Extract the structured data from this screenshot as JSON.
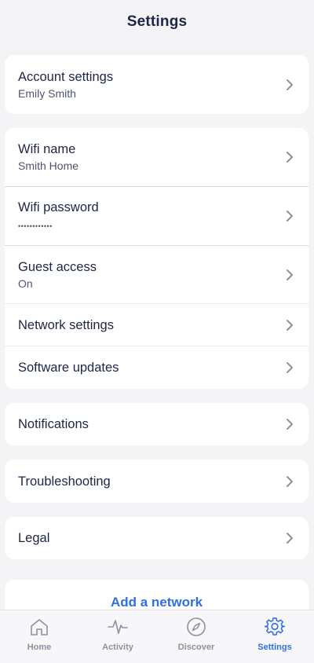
{
  "header": {
    "title": "Settings"
  },
  "account": {
    "label": "Account settings",
    "sub": "Emily Smith"
  },
  "wifi": {
    "name_label": "Wifi name",
    "name_value": "Smith Home",
    "password_label": "Wifi password",
    "password_value": "••••••••••••",
    "guest_label": "Guest access",
    "guest_value": "On",
    "network_label": "Network settings",
    "software_label": "Software updates"
  },
  "notifications": {
    "label": "Notifications"
  },
  "troubleshooting": {
    "label": "Troubleshooting"
  },
  "legal": {
    "label": "Legal"
  },
  "add_network": {
    "label": "Add a network"
  },
  "tabbar": {
    "home": "Home",
    "activity": "Activity",
    "discover": "Discover",
    "settings": "Settings"
  },
  "colors": {
    "accent": "#2f6fe0",
    "text": "#1f2547",
    "inactive": "#8d91a0",
    "background": "#f4f4f6"
  },
  "icons": {
    "chevron": "chevron-right-icon",
    "home": "home-icon",
    "activity": "activity-icon",
    "discover": "compass-icon",
    "settings": "gear-icon"
  }
}
